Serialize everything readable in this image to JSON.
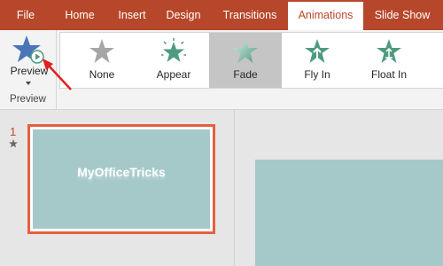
{
  "tabs": [
    "File",
    "Home",
    "Insert",
    "Design",
    "Transitions",
    "Animations",
    "Slide Show"
  ],
  "active_tab": "Animations",
  "preview": {
    "button_label": "Preview",
    "group_label": "Preview"
  },
  "effects": [
    {
      "label": "None",
      "icon": "star-gray-icon",
      "selected": false
    },
    {
      "label": "Appear",
      "icon": "star-burst-icon",
      "selected": false
    },
    {
      "label": "Fade",
      "icon": "star-fade-icon",
      "selected": true
    },
    {
      "label": "Fly In",
      "icon": "star-fly-in-icon",
      "selected": false
    },
    {
      "label": "Float In",
      "icon": "star-float-in-icon",
      "selected": false
    }
  ],
  "slides": [
    {
      "number": "1",
      "has_animation": true,
      "title_text": "MyOfficeTricks"
    }
  ],
  "colors": {
    "ribbon_red": "#b7472a",
    "accent_green": "#4e9a7f",
    "star_blue": "#4a76b8",
    "slide_teal": "#a5c9c9",
    "selection_orange": "#e4603e",
    "arrow_red": "#e41e1e"
  }
}
